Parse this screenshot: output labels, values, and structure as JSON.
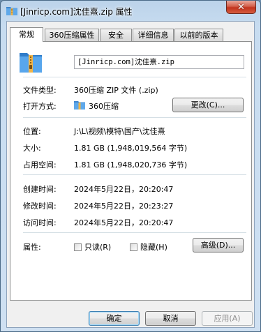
{
  "window": {
    "title": "[Jinricp.com]沈佳熹.zip 属性",
    "close_glyph": "✕"
  },
  "tabs": [
    {
      "label": "常规",
      "active": true
    },
    {
      "label": "360压缩属性",
      "active": false
    },
    {
      "label": "安全",
      "active": false
    },
    {
      "label": "详细信息",
      "active": false
    },
    {
      "label": "以前的版本",
      "active": false
    }
  ],
  "general": {
    "file_icon": "zip-archive-icon",
    "file_name": "[Jinricp.com]沈佳熹.zip",
    "file_type_label": "文件类型:",
    "file_type_value": "360压缩 ZIP 文件 (.zip)",
    "open_with_label": "打开方式:",
    "open_with_icon": "360-compress-icon",
    "open_with_value": "360压缩",
    "change_button": "更改(C)...",
    "location_label": "位置:",
    "location_value": "J:\\L\\视频\\模特\\国产\\沈佳熹",
    "size_label": "大小:",
    "size_value": "1.81 GB (1,948,019,564 字节)",
    "size_on_disk_label": "占用空间:",
    "size_on_disk_value": "1.81 GB (1,948,020,736 字节)",
    "created_label": "创建时间:",
    "created_value": "2024年5月22日，20:20:47",
    "modified_label": "修改时间:",
    "modified_value": "2024年5月22日，20:23:27",
    "accessed_label": "访问时间:",
    "accessed_value": "2024年5月22日，20:20:47",
    "attributes_label": "属性:",
    "readonly_label": "只读(R)",
    "readonly_checked": false,
    "hidden_label": "隐藏(H)",
    "hidden_checked": false,
    "advanced_button": "高级(D)..."
  },
  "footer": {
    "ok": "确定",
    "cancel": "取消",
    "apply": "应用(A)"
  },
  "colors": {
    "title_bar": "#c7dcf0",
    "close_button": "#c2331d",
    "folder_blue": "#4a90d9",
    "zipper_orange": "#e8a33a"
  }
}
